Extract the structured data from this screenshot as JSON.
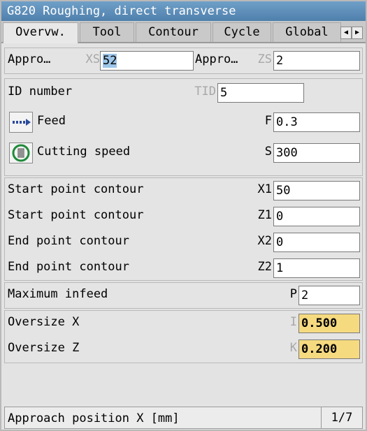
{
  "window": {
    "title": "G820 Roughing, direct transverse"
  },
  "tabs": [
    {
      "label": "Overvw."
    },
    {
      "label": "Tool"
    },
    {
      "label": "Contour"
    },
    {
      "label": "Cycle"
    },
    {
      "label": "Global"
    }
  ],
  "approach": {
    "left_label": "Appro…",
    "left_symbol": "XS",
    "left_value": "52",
    "right_label": "Appro…",
    "right_symbol": "ZS",
    "right_value": "2"
  },
  "tool": {
    "id_label": "ID number",
    "id_symbol": "TID",
    "id_value": "5",
    "feed_label": "Feed",
    "feed_symbol": "F",
    "feed_value": "0.3",
    "speed_label": "Cutting speed",
    "speed_symbol": "S",
    "speed_value": "300"
  },
  "contour": [
    {
      "label": "Start point contour",
      "symbol": "X1",
      "value": "50"
    },
    {
      "label": "Start point contour",
      "symbol": "Z1",
      "value": "0"
    },
    {
      "label": "End point contour",
      "symbol": "X2",
      "value": "0"
    },
    {
      "label": "End point contour",
      "symbol": "Z2",
      "value": "1"
    }
  ],
  "infeed": {
    "label": "Maximum infeed",
    "symbol": "P",
    "value": "2"
  },
  "oversize": [
    {
      "label": "Oversize X",
      "symbol": "I",
      "value": "0.500"
    },
    {
      "label": "Oversize Z",
      "symbol": "K",
      "value": "0.200"
    }
  ],
  "status": {
    "text": "Approach position X [mm]",
    "page": "1/7"
  },
  "icons": {
    "feed": "feed-arrow-icon",
    "speed": "cutting-speed-icon"
  },
  "colors": {
    "titlebar": "#5b8bb8",
    "highlight": "#9cc5e8",
    "oversize_field": "#f6da80"
  }
}
